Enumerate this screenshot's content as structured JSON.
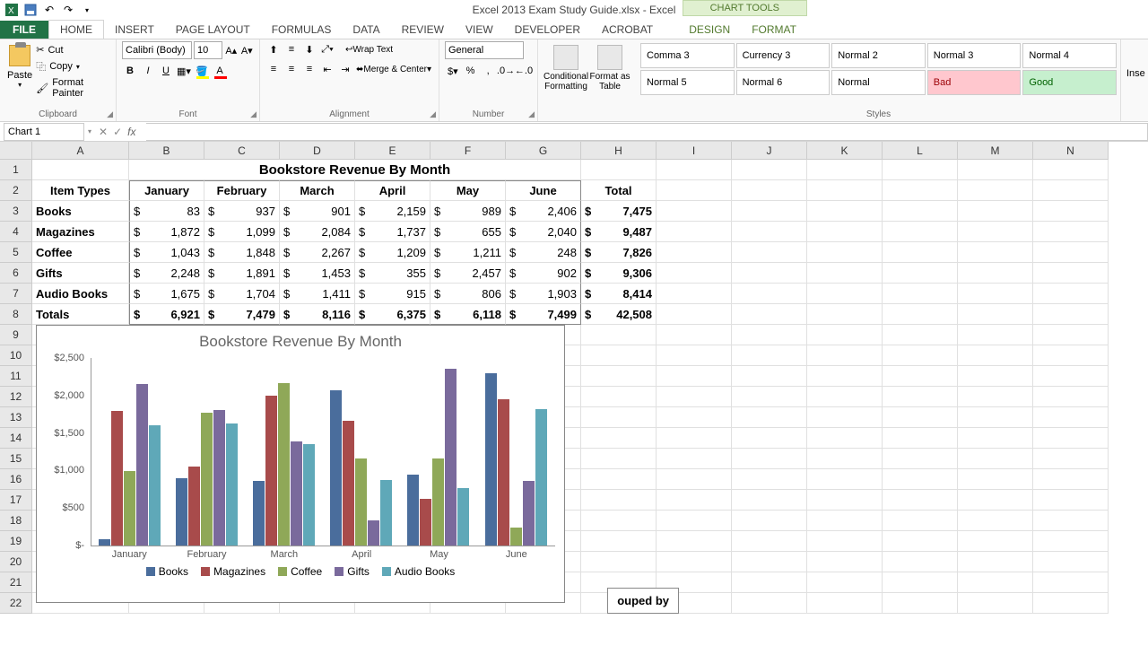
{
  "app": {
    "title": "Excel 2013 Exam Study Guide.xlsx - Excel",
    "chart_tools_label": "CHART TOOLS"
  },
  "qat": {
    "save": "Save",
    "undo": "Undo",
    "redo": "Redo"
  },
  "tabs": {
    "file": "FILE",
    "home": "HOME",
    "insert": "INSERT",
    "page_layout": "PAGE LAYOUT",
    "formulas": "FORMULAS",
    "data": "DATA",
    "review": "REVIEW",
    "view": "VIEW",
    "developer": "DEVELOPER",
    "acrobat": "ACROBAT",
    "design": "DESIGN",
    "format": "FORMAT"
  },
  "ribbon": {
    "clipboard": {
      "label": "Clipboard",
      "paste": "Paste",
      "cut": "Cut",
      "copy": "Copy",
      "format_painter": "Format Painter"
    },
    "font": {
      "label": "Font",
      "name": "Calibri (Body)",
      "size": "10",
      "bold": "B",
      "italic": "I",
      "underline": "U"
    },
    "alignment": {
      "label": "Alignment",
      "wrap": "Wrap Text",
      "merge": "Merge & Center"
    },
    "number": {
      "label": "Number",
      "format": "General"
    },
    "cond": {
      "cond_fmt": "Conditional Formatting",
      "fmt_table": "Format as Table"
    },
    "styles": {
      "label": "Styles",
      "items": [
        "Comma 3",
        "Currency 3",
        "Normal 2",
        "Normal 3",
        "Normal 4",
        "Normal 5",
        "Normal 6",
        "Normal",
        "Bad",
        "Good"
      ]
    },
    "insert_partial": "Inse"
  },
  "namebox": {
    "value": "Chart 1"
  },
  "columns": [
    "A",
    "B",
    "C",
    "D",
    "E",
    "F",
    "G",
    "H",
    "I",
    "J",
    "K",
    "L",
    "M",
    "N"
  ],
  "table": {
    "title": "Bookstore Revenue By Month",
    "headers": [
      "Item Types",
      "January",
      "February",
      "March",
      "April",
      "May",
      "June",
      "Total"
    ],
    "rows": [
      {
        "label": "Books",
        "vals": [
          "83",
          "937",
          "901",
          "2,159",
          "989",
          "2,406"
        ],
        "total": "7,475"
      },
      {
        "label": "Magazines",
        "vals": [
          "1,872",
          "1,099",
          "2,084",
          "1,737",
          "655",
          "2,040"
        ],
        "total": "9,487"
      },
      {
        "label": "Coffee",
        "vals": [
          "1,043",
          "1,848",
          "2,267",
          "1,209",
          "1,211",
          "248"
        ],
        "total": "7,826"
      },
      {
        "label": "Gifts",
        "vals": [
          "2,248",
          "1,891",
          "1,453",
          "355",
          "2,457",
          "902"
        ],
        "total": "9,306"
      },
      {
        "label": "Audio Books",
        "vals": [
          "1,675",
          "1,704",
          "1,411",
          "915",
          "806",
          "1,903"
        ],
        "total": "8,414"
      }
    ],
    "totals": {
      "label": "Totals",
      "vals": [
        "6,921",
        "7,479",
        "8,116",
        "6,375",
        "6,118",
        "7,499"
      ],
      "total": "42,508"
    }
  },
  "fragment": "ouped by",
  "chart_data": {
    "type": "bar",
    "title": "Bookstore Revenue By Month",
    "categories": [
      "January",
      "February",
      "March",
      "April",
      "May",
      "June"
    ],
    "series": [
      {
        "name": "Books",
        "values": [
          83,
          937,
          901,
          2159,
          989,
          2406
        ]
      },
      {
        "name": "Magazines",
        "values": [
          1872,
          1099,
          2084,
          1737,
          655,
          2040
        ]
      },
      {
        "name": "Coffee",
        "values": [
          1043,
          1848,
          2267,
          1209,
          1211,
          248
        ]
      },
      {
        "name": "Gifts",
        "values": [
          2248,
          1891,
          1453,
          355,
          2457,
          902
        ]
      },
      {
        "name": "Audio Books",
        "values": [
          1675,
          1704,
          1411,
          915,
          806,
          1903
        ]
      }
    ],
    "ylabel": "",
    "xlabel": "",
    "y_ticks": [
      "$-",
      "$500",
      "$1,000",
      "$1,500",
      "$2,000",
      "$2,500"
    ],
    "ylim": [
      0,
      2500
    ],
    "currency": "$"
  }
}
